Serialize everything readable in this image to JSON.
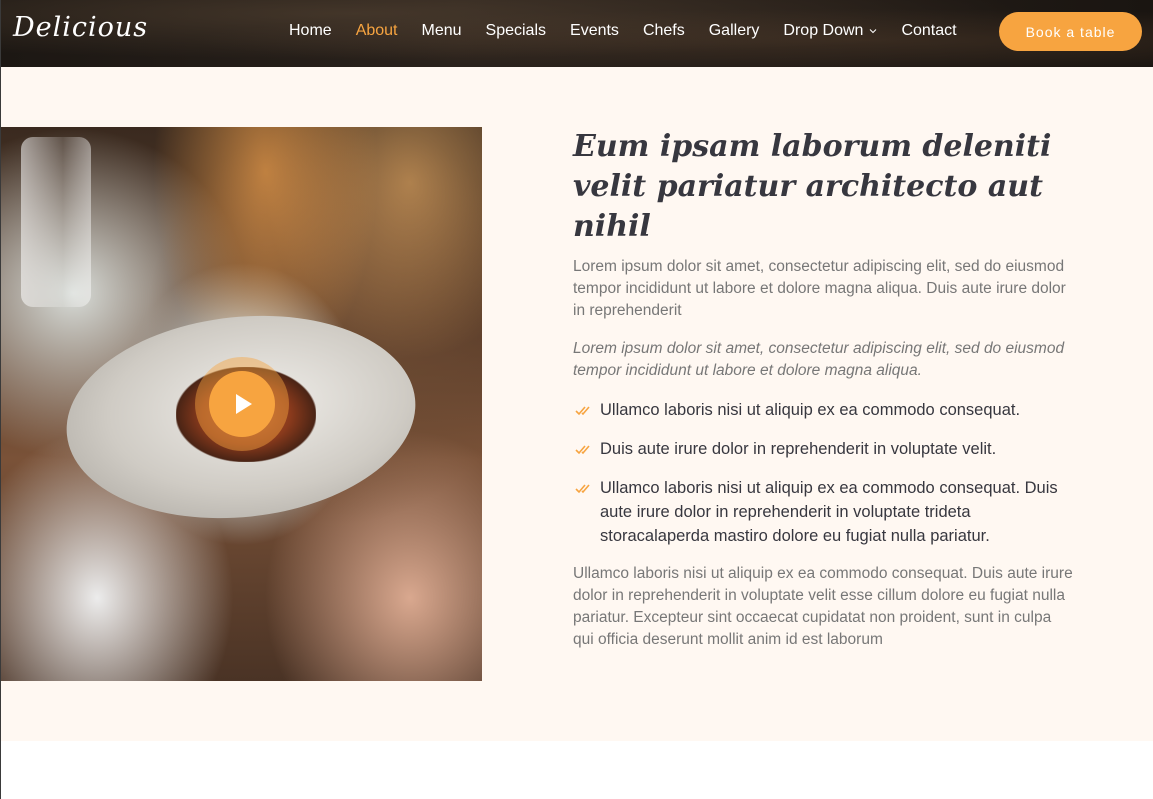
{
  "header": {
    "logo": "Delicious",
    "nav": [
      {
        "label": "Home",
        "active": false
      },
      {
        "label": "About",
        "active": true
      },
      {
        "label": "Menu",
        "active": false
      },
      {
        "label": "Specials",
        "active": false
      },
      {
        "label": "Events",
        "active": false
      },
      {
        "label": "Chefs",
        "active": false
      },
      {
        "label": "Gallery",
        "active": false
      },
      {
        "label": "Drop Down",
        "active": false,
        "icon": "chevron-down-icon"
      },
      {
        "label": "Contact",
        "active": false
      }
    ],
    "cta_label": "Book a table"
  },
  "colors": {
    "accent": "#f7a440",
    "section_bg": "#fff8f2",
    "heading": "#37373f",
    "body_text": "#777777"
  },
  "about": {
    "video_icon": "play-icon",
    "heading": "Eum ipsam laborum deleniti velit pariatur architecto aut nihil",
    "lead": "Lorem ipsum dolor sit amet, consectetur adipiscing elit, sed do eiusmod tempor incididunt ut labore et dolore magna aliqua. Duis aute irure dolor in reprehenderit",
    "italic": "Lorem ipsum dolor sit amet, consectetur adipiscing elit, sed do eiusmod tempor incididunt ut labore et dolore magna aliqua.",
    "checklist_icon": "double-check-icon",
    "checklist": [
      "Ullamco laboris nisi ut aliquip ex ea commodo consequat.",
      "Duis aute irure dolor in reprehenderit in voluptate velit.",
      "Ullamco laboris nisi ut aliquip ex ea commodo consequat. Duis aute irure dolor in reprehenderit in voluptate trideta storacalaperda mastiro dolore eu fugiat nulla pariatur."
    ],
    "tail": "Ullamco laboris nisi ut aliquip ex ea commodo consequat. Duis aute irure dolor in reprehenderit in voluptate velit esse cillum dolore eu fugiat nulla pariatur. Excepteur sint occaecat cupidatat non proident, sunt in culpa qui officia deserunt mollit anim id est laborum"
  }
}
